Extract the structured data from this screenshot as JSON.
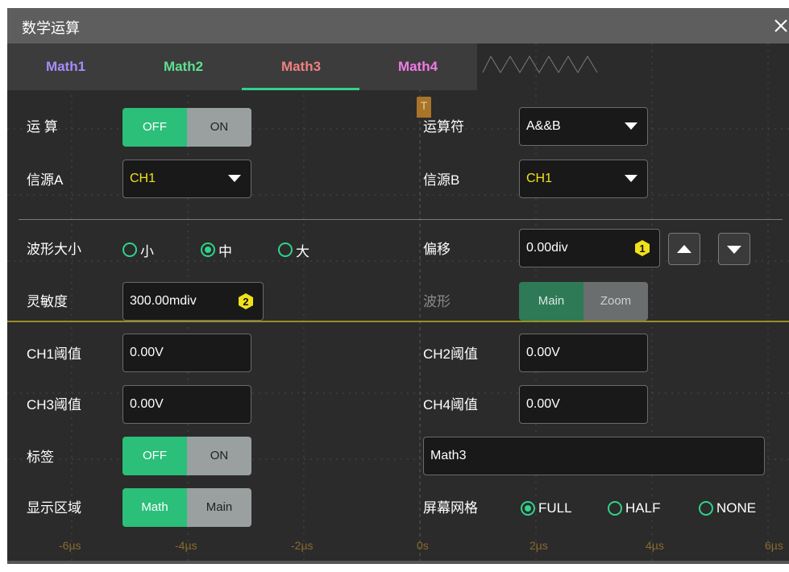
{
  "dialog": {
    "title": "数学运算"
  },
  "tabs": [
    {
      "label": "Math1",
      "color": "#a78bfa"
    },
    {
      "label": "Math2",
      "color": "#5ee08f"
    },
    {
      "label": "Math3",
      "color": "#f08080",
      "active": true
    },
    {
      "label": "Math4",
      "color": "#f07ae8"
    }
  ],
  "rows": {
    "operation": {
      "label": "运 算",
      "off": "OFF",
      "on": "ON",
      "selected": "OFF"
    },
    "operator": {
      "label": "运算符",
      "value": "A&&B"
    },
    "sourceA": {
      "label": "信源A",
      "value": "CH1"
    },
    "sourceB": {
      "label": "信源B",
      "value": "CH1"
    },
    "wave_size": {
      "label": "波形大小",
      "options": [
        "小",
        "中",
        "大"
      ],
      "selected": "中"
    },
    "offset": {
      "label": "偏移",
      "value": "0.00div",
      "knob": "1"
    },
    "sensitivity": {
      "label": "灵敏度",
      "value": "300.00mdiv",
      "knob": "2"
    },
    "waveform": {
      "label": "波形",
      "main": "Main",
      "zoom": "Zoom",
      "selected": "Main"
    },
    "ch1_threshold": {
      "label": "CH1阈值",
      "value": "0.00V"
    },
    "ch2_threshold": {
      "label": "CH2阈值",
      "value": "0.00V"
    },
    "ch3_threshold": {
      "label": "CH3阈值",
      "value": "0.00V"
    },
    "ch4_threshold": {
      "label": "CH4阈值",
      "value": "0.00V"
    },
    "label": {
      "label": "标签",
      "off": "OFF",
      "on": "ON",
      "selected": "OFF",
      "text": "Math3"
    },
    "display_area": {
      "label": "显示区域",
      "math": "Math",
      "main": "Main",
      "selected": "Math"
    },
    "grid": {
      "label": "屏幕网格",
      "options": [
        "FULL",
        "HALF",
        "NONE"
      ],
      "selected": "FULL"
    }
  },
  "background": {
    "trigger_marker": "T",
    "time_axis": [
      "-6µs",
      "-4µs",
      "-2µs",
      "0s",
      "2µs",
      "4µs",
      "6µs"
    ]
  },
  "colors": {
    "accent": "#2bbf7a",
    "trace": "#b8a826",
    "knob": "#f2e01a"
  }
}
